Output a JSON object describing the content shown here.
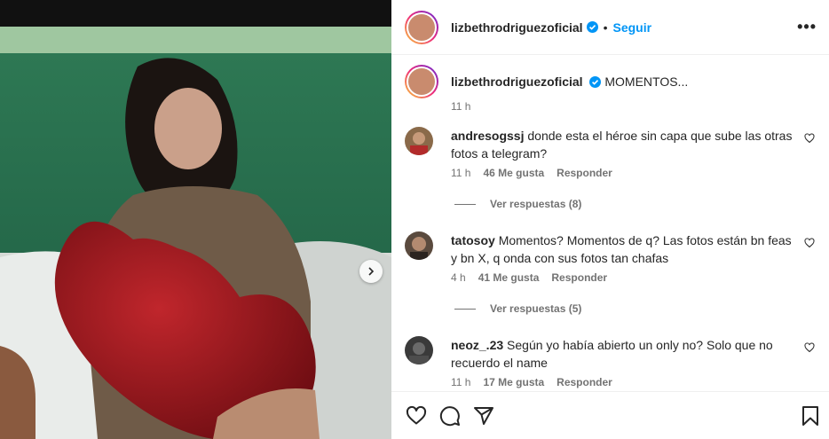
{
  "post": {
    "username": "lizbethrodriguezoficial",
    "follow_label": "Seguir",
    "dot": "•",
    "more_label": "•••",
    "caption": "MOMENTOS...",
    "caption_time": "11 h"
  },
  "comments": [
    {
      "username": "andresogssj",
      "text": "donde esta el héroe sin capa que sube las otras fotos a telegram?",
      "time": "11 h",
      "likes": "46 Me gusta",
      "reply": "Responder",
      "view_replies": "Ver respuestas (8)"
    },
    {
      "username": "tatosoy",
      "text": "Momentos? Momentos de q? Las fotos están bn feas y bn X, q onda con sus fotos tan chafas",
      "time": "4 h",
      "likes": "41 Me gusta",
      "reply": "Responder",
      "view_replies": "Ver respuestas (5)"
    },
    {
      "username": "neoz_.23",
      "text": "Según yo había abierto un only no? Solo que no recuerdo el name",
      "time": "11 h",
      "likes": "17 Me gusta",
      "reply": "Responder"
    }
  ],
  "colors": {
    "accent": "#0095f6",
    "verified": "#0095f6",
    "muted": "#737373",
    "text": "#262626"
  },
  "icons": {
    "verified": "verified-badge-icon",
    "like": "heart-icon",
    "comment": "comment-icon",
    "share": "paper-plane-icon",
    "save": "bookmark-icon",
    "next": "chevron-right-icon"
  }
}
